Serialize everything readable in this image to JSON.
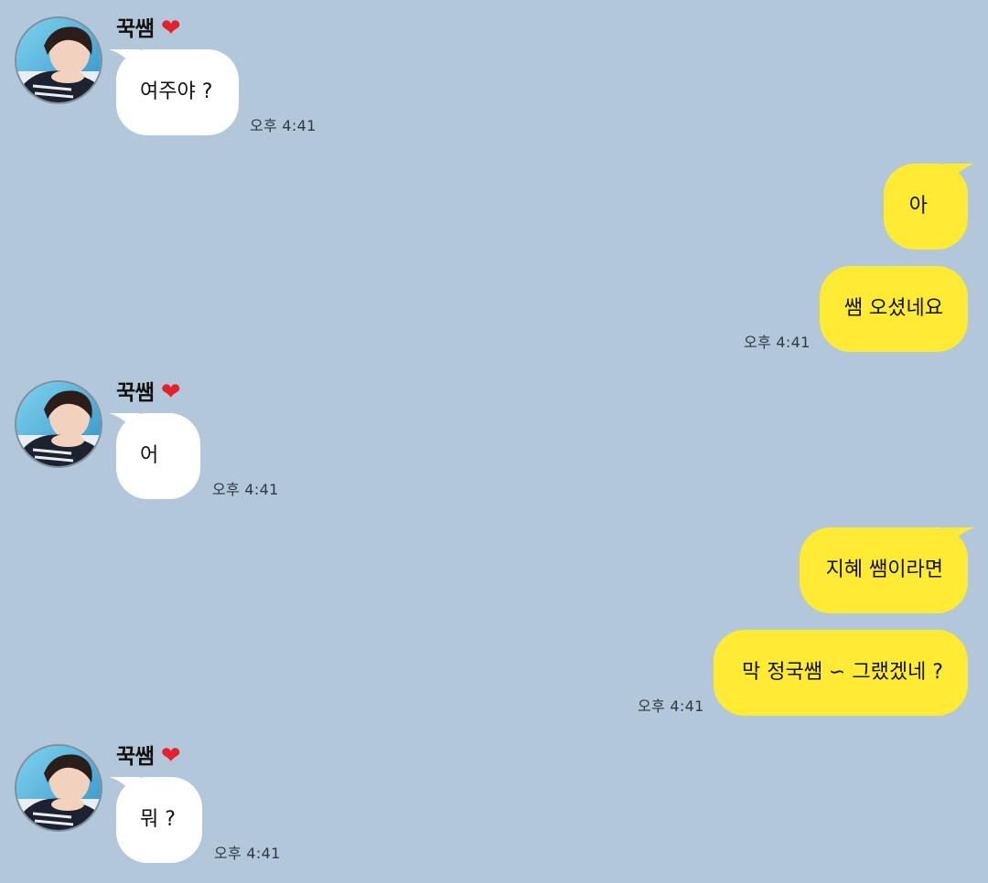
{
  "chat": {
    "bubble_colors": {
      "incoming": "#ffffff",
      "outgoing": "#ffeb33"
    },
    "background_color": "#b2c7da",
    "messages": [
      {
        "sender": "꾹쌤",
        "heart": "❤",
        "text": "여주야 ?",
        "time": "오후 4:41",
        "direction": "in"
      },
      {
        "text": "아",
        "direction": "out"
      },
      {
        "text": "쌤 오셨네요",
        "time": "오후 4:41",
        "direction": "out"
      },
      {
        "sender": "꾹쌤",
        "heart": "❤",
        "text": "어",
        "time": "오후 4:41",
        "direction": "in"
      },
      {
        "text": "지혜 쌤이라면",
        "direction": "out"
      },
      {
        "text": "막 정국쌤 ∽ 그랬겠네 ?",
        "time": "오후 4:41",
        "direction": "out"
      },
      {
        "sender": "꾹쌤",
        "heart": "❤",
        "text": "뭐 ?",
        "time": "오후 4:41",
        "direction": "in"
      }
    ]
  }
}
